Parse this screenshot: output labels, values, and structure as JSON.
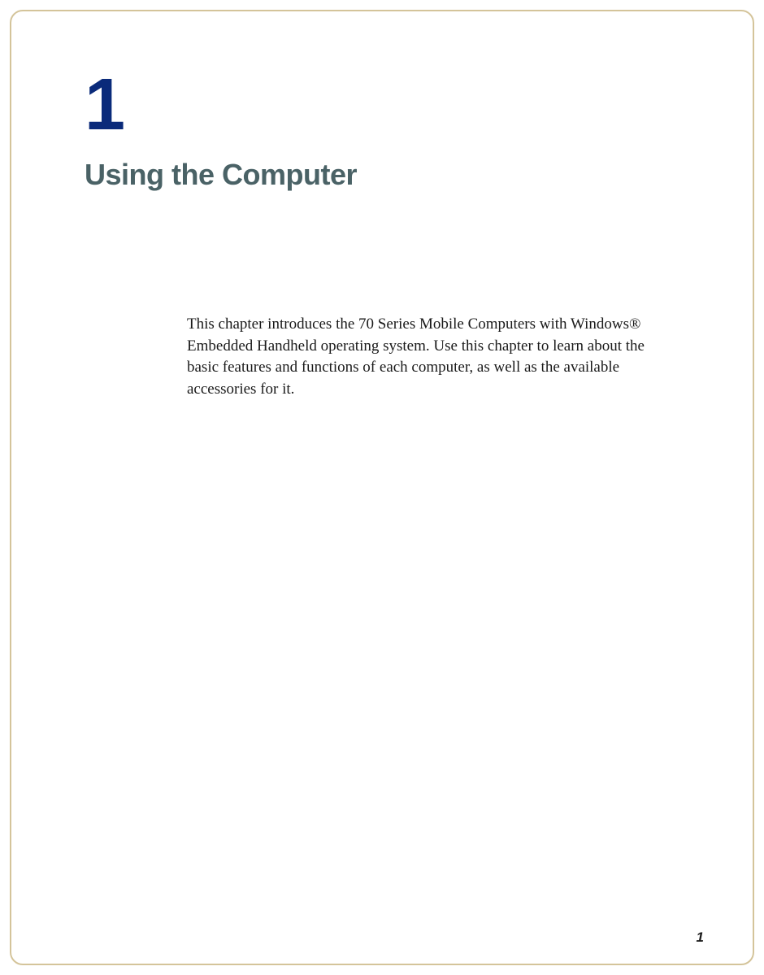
{
  "chapter": {
    "number": "1",
    "title": "Using the Computer",
    "intro": "This chapter introduces the 70 Series Mobile Computers with Windows® Embedded Handheld operating system. Use this chapter to learn about the basic features and functions of each computer, as well as the available accessories for it."
  },
  "page_number": "1"
}
